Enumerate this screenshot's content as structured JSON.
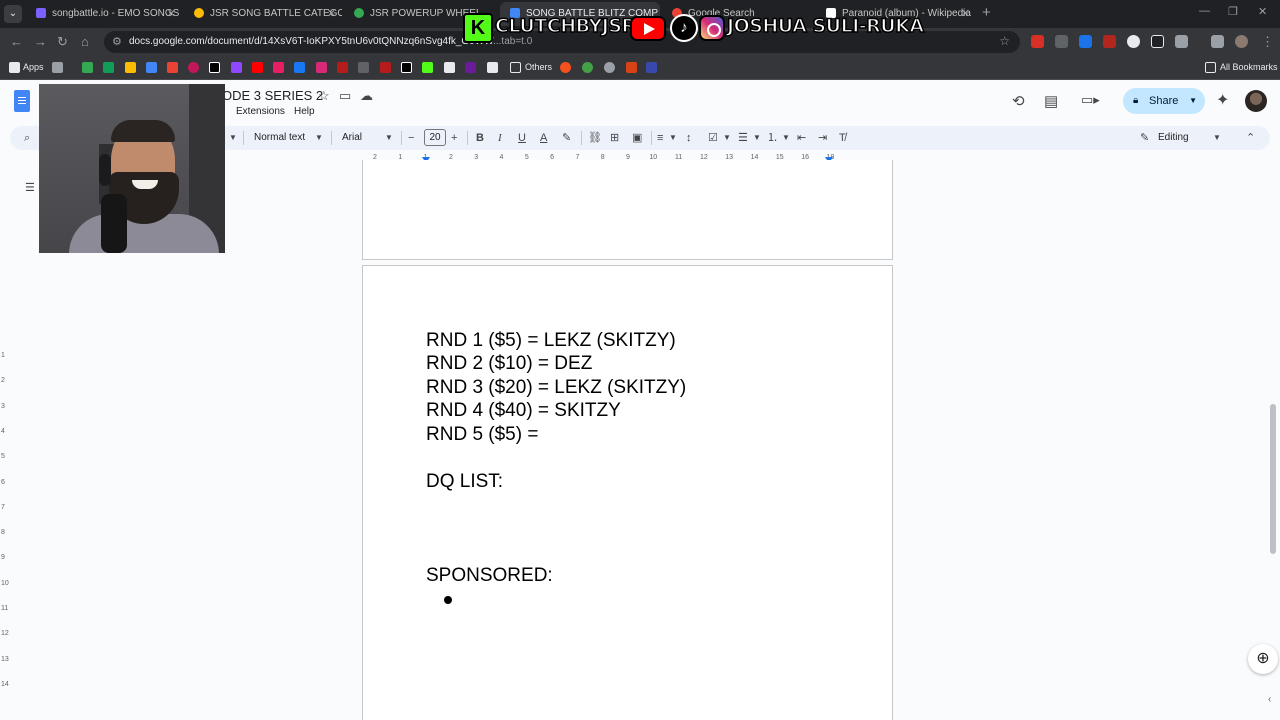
{
  "browser": {
    "tabs": [
      {
        "title": "songbattle.io - EMO SONGS",
        "favicon_color": "#7b61ff"
      },
      {
        "title": "JSR SONG BATTLE CATEGORY",
        "favicon_color": "#fbbc04"
      },
      {
        "title": "JSR POWERUP WHEEL",
        "favicon_color": "#34a853"
      },
      {
        "title": "SONG BATTLE BLITZ COMP - ",
        "favicon_color": "#4285f4"
      },
      {
        "title": "Google Search",
        "favicon_color": "#ea4335"
      },
      {
        "title": "Paranoid (album) - Wikipedia",
        "favicon_color": "#ffffff"
      }
    ],
    "url": "docs.google.com/document/d/14XsV6T-IoKPXY5tnU6v0tQNNzq6nSvg4fk_G0WW",
    "url_tail": "...tab=t.0",
    "bookmarks": {
      "apps_label": "Apps",
      "others_label": "Others",
      "all_bookmarks_label": "All Bookmarks"
    }
  },
  "docs": {
    "title_partial": "ODE 3 SERIES 2",
    "menus": [
      "Extensions",
      "Help"
    ],
    "share_label": "Share",
    "toolbar": {
      "style": "Normal text",
      "font": "Arial",
      "font_size": "20",
      "mode": "Editing"
    },
    "ruler_numbers": [
      "2",
      "1",
      "1",
      "2",
      "3",
      "4",
      "5",
      "6",
      "7",
      "8",
      "9",
      "10",
      "11",
      "12",
      "13",
      "14",
      "15",
      "16",
      "18"
    ],
    "vertical_ruler_numbers": [
      "1",
      "2",
      "3",
      "4",
      "5",
      "6",
      "7",
      "8",
      "9",
      "10",
      "11",
      "12",
      "13",
      "14"
    ],
    "content": {
      "lines": [
        "RND 1 ($5) = LEKZ (SKITZY)",
        "RND 2 ($10) = DEZ",
        "RND 3 ($20) = LEKZ (SKITZY)",
        "RND 4 ($40) = SKITZY",
        "RND 5 ($5) = "
      ],
      "dq_heading": "DQ LIST:",
      "sponsored_heading": "SPONSORED:"
    }
  },
  "overlay": {
    "kick_letter": "K",
    "kick_handle": "CLUTCHBYJSR",
    "social_name": "JOSHUA SULI-RUKA",
    "tiktok_glyph": "♪",
    "colors": {
      "kick": "#53fc18",
      "youtube": "#ff0000"
    }
  }
}
